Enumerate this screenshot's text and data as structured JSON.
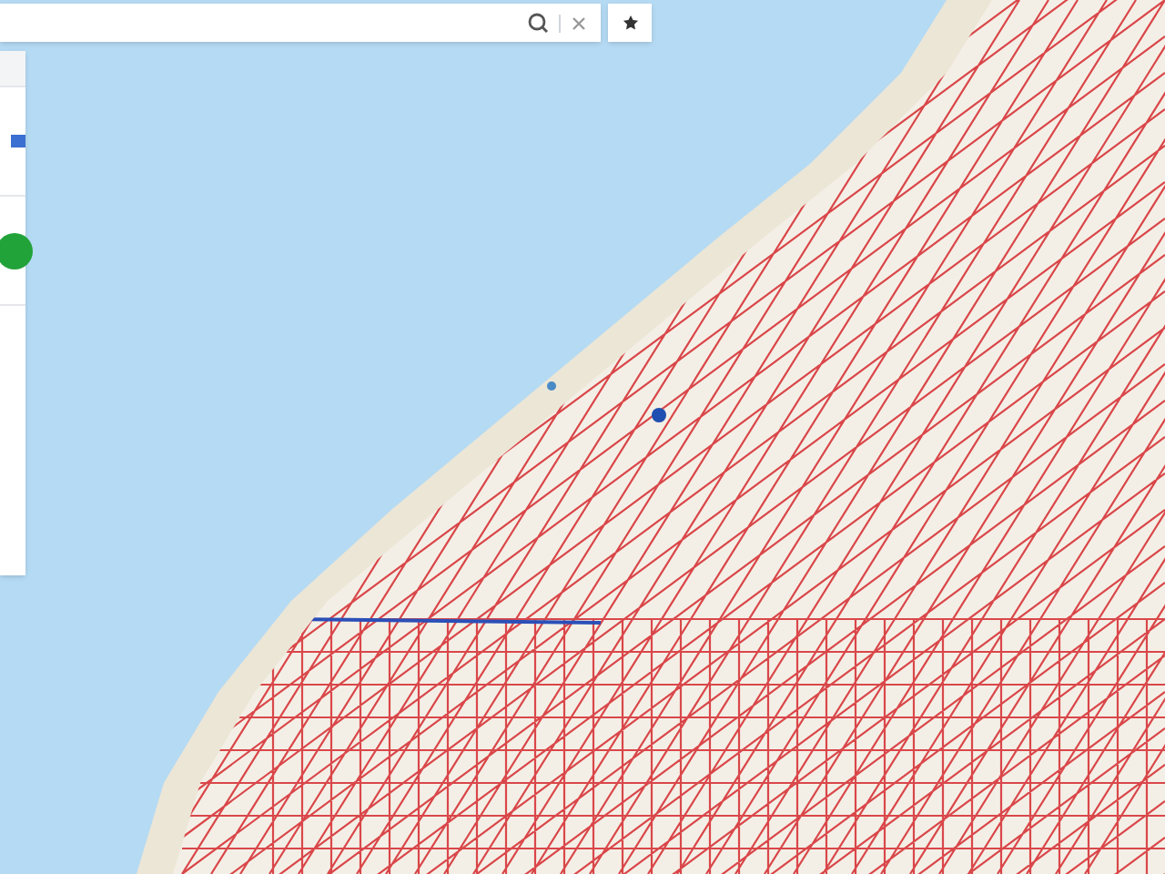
{
  "map": {
    "kind": "cadastral"
  },
  "search": {
    "clearable": true
  },
  "side_panel": {
    "items": [
      {
        "kind": "badge"
      },
      {
        "kind": "status",
        "color": "#22a33a"
      }
    ]
  }
}
